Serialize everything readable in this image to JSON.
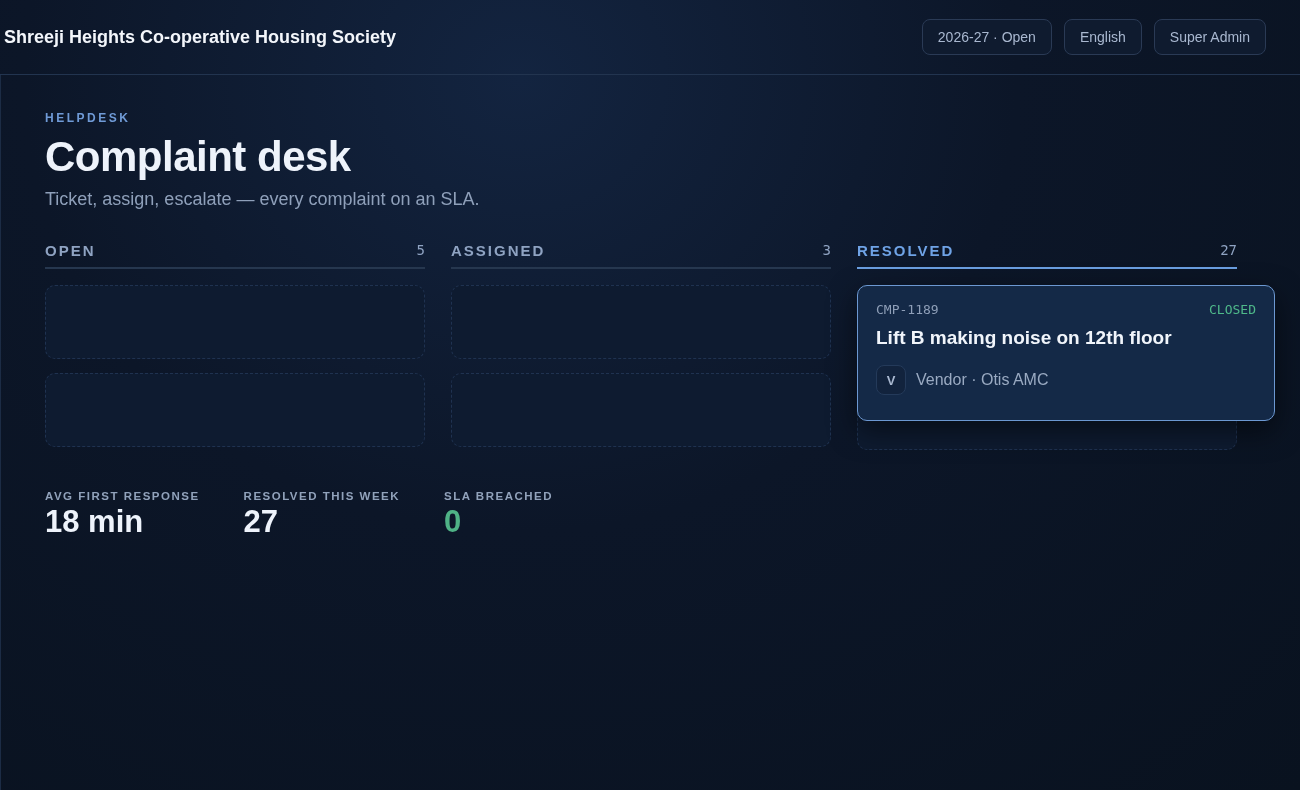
{
  "header": {
    "title": "Shreeji Heights Co-operative Housing Society",
    "chips": [
      "2026-27 · Open",
      "English",
      "Super Admin"
    ]
  },
  "page": {
    "eyebrow": "HELPDESK",
    "title": "Complaint desk",
    "subtitle": "Ticket, assign, escalate — every complaint on an SLA."
  },
  "columns": [
    {
      "label": "OPEN",
      "count": "5",
      "selected": false,
      "slots": [
        {
          "kind": "empty"
        },
        {
          "kind": "empty"
        }
      ]
    },
    {
      "label": "ASSIGNED",
      "count": "3",
      "selected": false,
      "slots": [
        {
          "kind": "empty"
        },
        {
          "kind": "empty"
        }
      ]
    },
    {
      "label": "RESOLVED",
      "count": "27",
      "selected": true,
      "slots": [
        {
          "kind": "card",
          "id": "CMP-1189",
          "status": "CLOSED",
          "title": "Lift B making noise on 12th floor",
          "avatar": "V",
          "assignee": "Vendor · Otis AMC"
        },
        {
          "kind": "empty"
        }
      ]
    }
  ],
  "stats": [
    {
      "label": "AVG FIRST RESPONSE",
      "value": "18 min",
      "kind": "plain"
    },
    {
      "label": "RESOLVED THIS WEEK",
      "value": "27",
      "kind": "plain"
    },
    {
      "label": "SLA BREACHED",
      "value": "0",
      "kind": "good"
    }
  ]
}
